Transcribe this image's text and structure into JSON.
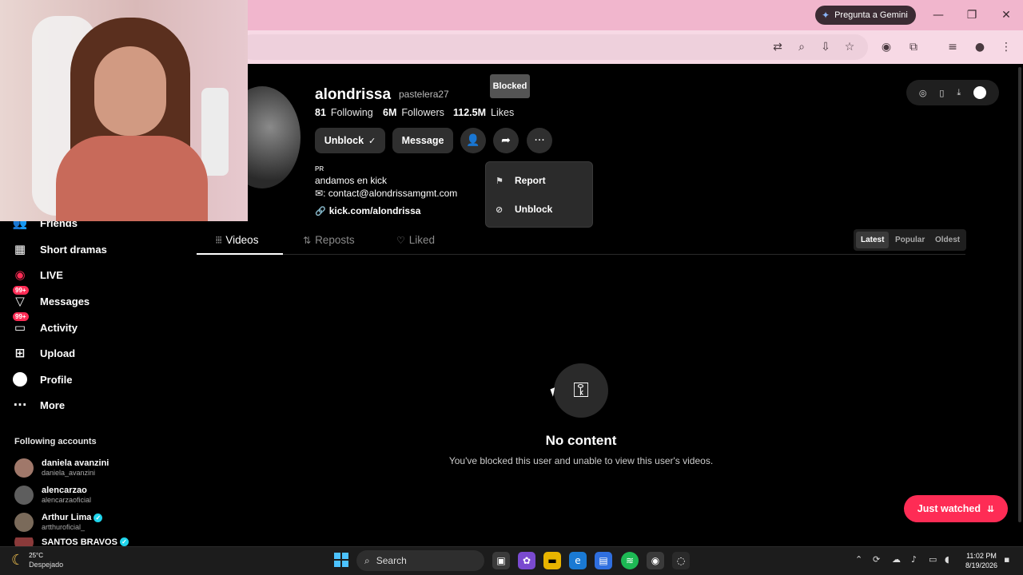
{
  "browser": {
    "gemini_label": "Pregunta a Gemini"
  },
  "sidebar": {
    "items": [
      {
        "label": "Friends",
        "icon": "friends-icon"
      },
      {
        "label": "Short dramas",
        "icon": "film-icon"
      },
      {
        "label": "LIVE",
        "icon": "live-icon"
      },
      {
        "label": "Messages",
        "icon": "messages-icon",
        "badge": "99+"
      },
      {
        "label": "Activity",
        "icon": "activity-icon",
        "badge": "99+"
      },
      {
        "label": "Upload",
        "icon": "upload-icon"
      },
      {
        "label": "Profile",
        "icon": "profile-icon"
      },
      {
        "label": "More",
        "icon": "more-icon"
      }
    ],
    "following_title": "Following accounts",
    "accounts": [
      {
        "name": "daniela avanzini",
        "handle": "daniela_avanzini",
        "verified": false
      },
      {
        "name": "alencarzao",
        "handle": "alencarzaoficial",
        "verified": false
      },
      {
        "name": "Arthur Lima",
        "handle": "artthuroficial_",
        "verified": true
      },
      {
        "name": "SANTOS BRAVOS",
        "handle": "",
        "verified": true
      }
    ]
  },
  "profile": {
    "username": "alondrissa",
    "nickname": "pastelera27",
    "blocked_tooltip": "Blocked",
    "following_count": "81",
    "following_label": "Following",
    "followers_count": "6M",
    "followers_label": "Followers",
    "likes_count": "112.5M",
    "likes_label": "Likes",
    "unblock_button": "Unblock",
    "message_button": "Message",
    "bio_label": "PR",
    "bio_line1": "andamos en kick",
    "bio_line2": ": contact@alondrissamgmt.com",
    "link": "kick.com/alondrissa"
  },
  "menu": {
    "report": "Report",
    "unblock": "Unblock"
  },
  "tabs": {
    "videos": "Videos",
    "reposts": "Reposts",
    "liked": "Liked"
  },
  "sort": {
    "latest": "Latest",
    "popular": "Popular",
    "oldest": "Oldest",
    "selected": "Latest"
  },
  "empty": {
    "title": "No content",
    "subtitle": "You've blocked this user and unable to view this user's videos."
  },
  "just_watched": "Just watched",
  "taskbar": {
    "temperature": "25°C",
    "weather": "Despejado",
    "search": "Search",
    "time": "11:02 PM",
    "date": "8/19/2026"
  },
  "colors": {
    "accent": "#fe2c55",
    "verified": "#20d5ec",
    "chrome_frame": "#f1b6cd"
  }
}
